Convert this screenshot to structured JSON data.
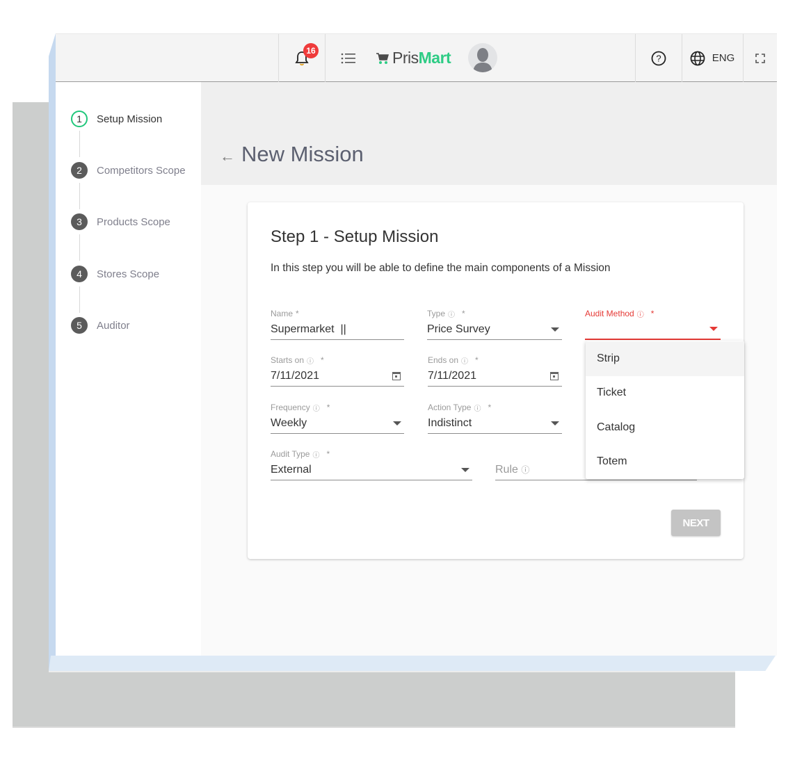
{
  "header": {
    "notification_count": "16",
    "brand_prefix": "Pris",
    "brand_suffix": "Mart",
    "language": "ENG",
    "icons": {
      "notifications": "bell-icon",
      "menu": "list-icon",
      "brand": "cart-icon",
      "avatar": "user-avatar",
      "help": "help-circle-icon",
      "language": "globe-icon",
      "fullscreen": "fullscreen-icon"
    }
  },
  "stepper": {
    "steps": [
      {
        "number": "1",
        "label": "Setup Mission",
        "active": true
      },
      {
        "number": "2",
        "label": "Competitors Scope",
        "active": false
      },
      {
        "number": "3",
        "label": "Products Scope",
        "active": false
      },
      {
        "number": "4",
        "label": "Stores Scope",
        "active": false
      },
      {
        "number": "5",
        "label": "Auditor",
        "active": false
      }
    ]
  },
  "page": {
    "back_arrow": "←",
    "title": "New Mission"
  },
  "card": {
    "title": "Step 1 - Setup Mission",
    "description": "In this step you will be able to define the main components of a Mission",
    "fields": {
      "name": {
        "label": "Name",
        "required": "*",
        "value": "Supermarket  ||"
      },
      "type": {
        "label": "Type",
        "info": "ⓘ",
        "required": "*",
        "value": "Price Survey"
      },
      "audit_method": {
        "label": "Audit Method",
        "info": "ⓘ",
        "required": "*",
        "value": ""
      },
      "starts_on": {
        "label": "Starts on",
        "info": "ⓘ",
        "required": "*",
        "value": "7/11/2021"
      },
      "ends_on": {
        "label": "Ends on",
        "info": "ⓘ",
        "required": "*",
        "value": "7/11/2021"
      },
      "frequency": {
        "label": "Frequency",
        "info": "ⓘ",
        "required": "*",
        "value": "Weekly"
      },
      "action_type": {
        "label": "Action Type",
        "info": "ⓘ",
        "required": "*",
        "value": "Indistinct"
      },
      "audit_type": {
        "label": "Audit Type",
        "info": "ⓘ",
        "required": "*",
        "value": "External"
      },
      "rule": {
        "placeholder": "Rule",
        "info": "ⓘ",
        "value": ""
      }
    },
    "next_label": "NEXT"
  },
  "audit_method_dropdown": {
    "options": [
      "Strip",
      "Ticket",
      "Catalog",
      "Totem"
    ],
    "highlighted": "Strip"
  },
  "colors": {
    "brand_green": "#2ecc85",
    "active_step": "#20c77b",
    "error_red": "#e53935",
    "badge_red": "#ef3b3b",
    "disabled_button": "#c4c4c4"
  }
}
